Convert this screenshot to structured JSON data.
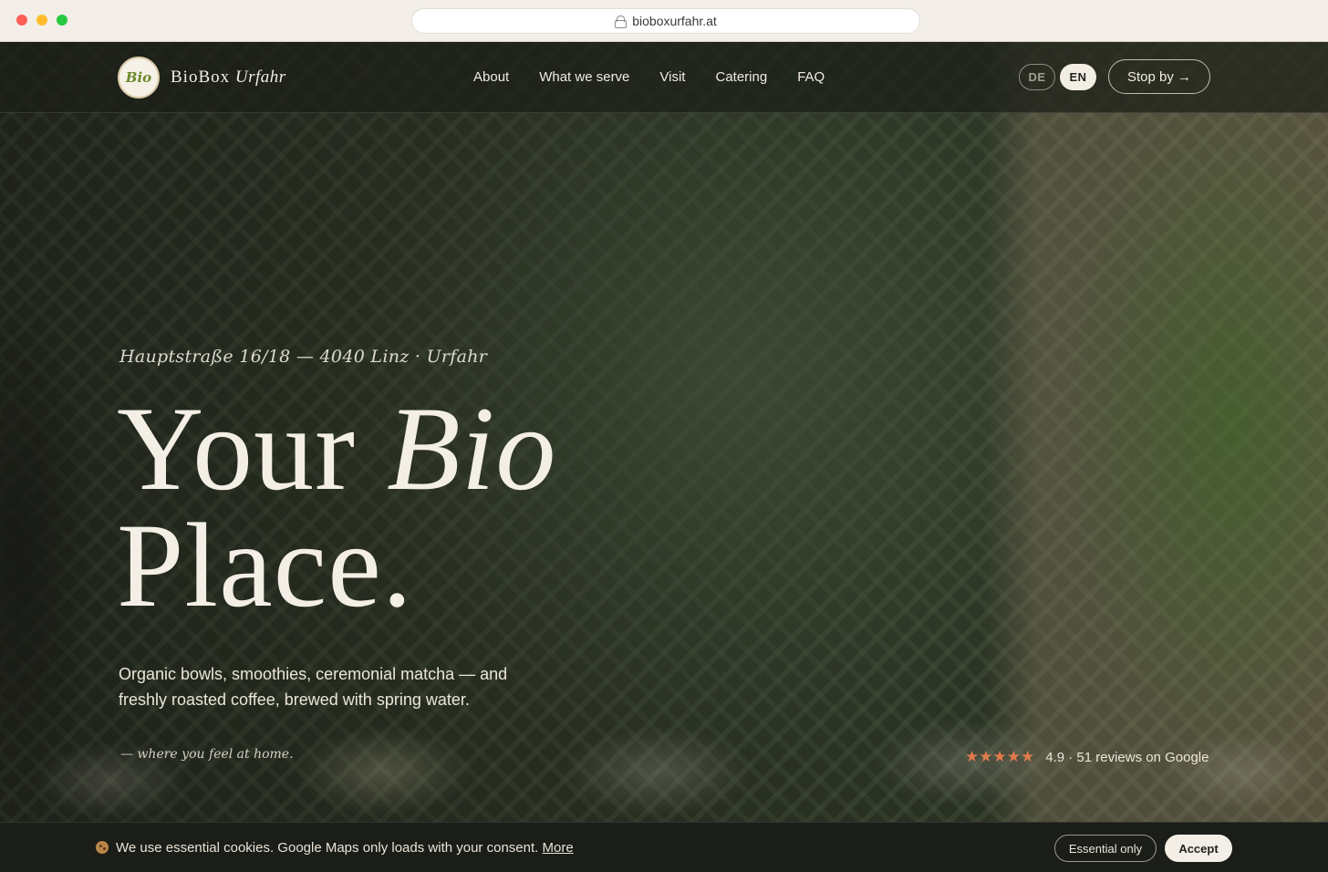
{
  "browser": {
    "url": "bioboxurfahr.at"
  },
  "nav": {
    "logo_mark": "Bio",
    "brand_main": "BioBox",
    "brand_italic": "Urfahr",
    "links": [
      "About",
      "What we serve",
      "Visit",
      "Catering",
      "FAQ"
    ],
    "lang_de": "DE",
    "lang_en": "EN",
    "active_lang": "EN",
    "cta": "Stop by →"
  },
  "hero": {
    "address": "Hauptstraße 16/18 — 4040 Linz · Urfahr",
    "headline_word1": "Your",
    "headline_word2": "Bio",
    "headline_word3": "Place.",
    "description": "Organic bowls, smoothies, ceremonial matcha — and freshly roasted coffee, brewed with spring water.",
    "tagline": "— where you feel at home.",
    "rating": {
      "stars": "★★★★★",
      "star_count": 5,
      "text": "4.9 · 51 reviews on Google"
    }
  },
  "cookie_bar": {
    "text": "We use essential cookies. Google Maps only loads with your consent.",
    "more_link": "More",
    "essential_button": "Essential only",
    "accept_button": "Accept"
  },
  "colors": {
    "accent_star": "#e07a4a",
    "cream": "#f4efe6",
    "dark": "#1f221c"
  }
}
